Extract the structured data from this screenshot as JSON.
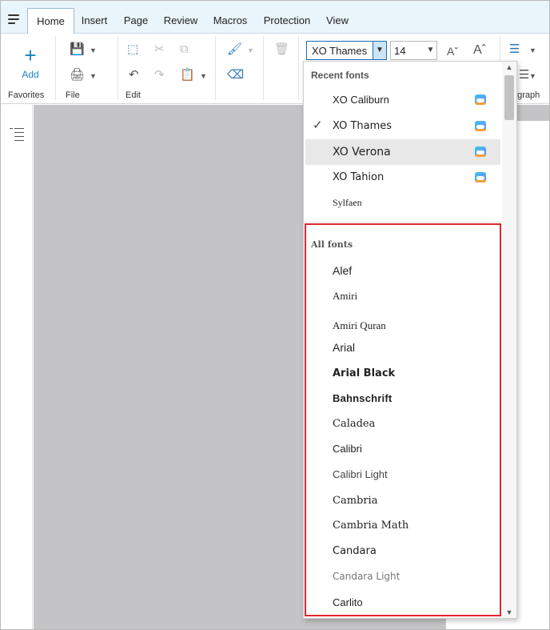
{
  "tabs": [
    {
      "label": "Home",
      "active": true
    },
    {
      "label": "Insert"
    },
    {
      "label": "Page"
    },
    {
      "label": "Review"
    },
    {
      "label": "Macros"
    },
    {
      "label": "Protection"
    },
    {
      "label": "View"
    }
  ],
  "ribbon": {
    "add_label": "Add",
    "groups": {
      "favorites": "Favorites",
      "file": "File",
      "edit": "Edit",
      "paragraph_partial": "agraph"
    },
    "font_name": "XO Thames",
    "font_size": "14"
  },
  "dropdown": {
    "recent_heading": "Recent fonts",
    "recent": [
      {
        "name": "XO Caliburn",
        "cloud": true
      },
      {
        "name": "XO Thames",
        "cloud": true,
        "checked": true
      },
      {
        "name": "XO Verona",
        "cloud": true,
        "hover": true
      },
      {
        "name": "XO Tahion",
        "cloud": true
      },
      {
        "name": "Sylfaen",
        "cloud": false
      }
    ],
    "all_heading": "All fonts",
    "all": [
      "Alef",
      "Amiri",
      "Amiri Quran",
      "Arial",
      "Arial Black",
      "Bahnschrift",
      "Caladea",
      "Calibri",
      "Calibri Light",
      "Cambria",
      "Cambria Math",
      "Candara",
      "Candara Light",
      "Carlito"
    ]
  },
  "colors": {
    "accent": "#1a82c4",
    "tabbar": "#eaf4fb",
    "highlight": "#e0262d",
    "canvas": "#c4c4c6"
  }
}
